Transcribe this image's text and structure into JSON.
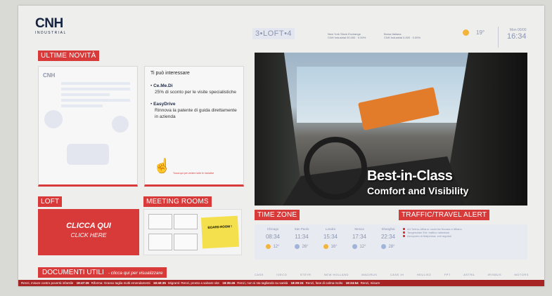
{
  "header": {
    "logo_main": "CNH",
    "logo_sub": "INDUSTRIAL",
    "loft_logo": "3•LOFT•4",
    "market_1_title": "New York Stock Exchange",
    "market_1_line": "CNH Industrial 00.000 · 0.00%",
    "market_2_title": "Borsa Italiana",
    "market_2_line": "CNH Industrial 0.000 · 0.00%",
    "weather_temp": "19°",
    "weather_temp_2": "19°",
    "date": "Mon 00/00",
    "time": "16:34"
  },
  "sections": {
    "news_title": "ULTIME NOVITÀ",
    "loft_title": "LOFT",
    "meeting_title": "MEETING ROOMS",
    "timezone_title": "TIME ZONE",
    "traffic_title": "TRAFFIC/TRAVEL ALERT"
  },
  "news_doc": {
    "mini_logo": "CNH"
  },
  "info_card": {
    "heading": "Ti può interessare",
    "items": [
      {
        "title": "Ce.Me.Di",
        "text": "25% di sconto per le visite specialistiche"
      },
      {
        "title": "EasyDrive",
        "text": "Rinnova la patente di guida direttamente in azienda"
      }
    ],
    "footer": "Tocca qui per vedere tutte le iniziative"
  },
  "video": {
    "caption_1": "Best-in-Class",
    "caption_2": "Comfort and Visibility"
  },
  "loft_box": {
    "line_1": "CLICCA QUI",
    "line_2": "CLICK HERE"
  },
  "meeting": {
    "sticky_label": "BOARD ROOM !"
  },
  "timezones": [
    {
      "city": "Chicago",
      "time": "08:34",
      "temp": "12°",
      "icon": "sun-icon"
    },
    {
      "city": "San Paolo",
      "time": "11:34",
      "temp": "26°",
      "icon": "cloud-icon"
    },
    {
      "city": "Londra",
      "time": "15:34",
      "temp": "16°",
      "icon": "sun-icon"
    },
    {
      "city": "Mosca",
      "time": "17:34",
      "temp": "12°",
      "icon": "cloud-icon"
    },
    {
      "city": "Shanghai",
      "time": "22:34",
      "temp": "28°",
      "icon": "cloud-icon"
    }
  ],
  "traffic": {
    "line_1": "A4 Torino–Milano: coda tra Novara e Milano",
    "line_2": "Tangenziale Est: traffico rallentato",
    "line_3": "Aeroporto di Malpensa: voli regolari"
  },
  "docs": {
    "label": "DOCUMENTI UTILI",
    "hint": "- clicca qui per visualizzare"
  },
  "brands": [
    "CASE",
    "IVECO",
    "STEYR",
    "NEW HOLLAND",
    "MAGIRUS",
    "CASE IH",
    "HEULIEZ",
    "FPT",
    "ASTRA",
    "IRISBUS",
    "MOTORS"
  ],
  "ticker": [
    {
      "time": "",
      "text": "Renzi, misure contro povertà infantile"
    },
    {
      "time": "18:47:26",
      "text": "Riforma: Grasso taglia molti emendamenti"
    },
    {
      "time": "18:40:35",
      "text": "Migranti: Renzi, pronto a salvare vite"
    },
    {
      "time": "18:35:45",
      "text": "Renzi, non si sta tagliando su sanità"
    },
    {
      "time": "18:29:24",
      "text": "Renzi, fase di calma molto"
    },
    {
      "time": "18:24:54",
      "text": "Renzi, misure"
    }
  ],
  "colors": {
    "accent": "#d83a3a",
    "brand_navy": "#15233f",
    "muted": "#8a95b0"
  }
}
